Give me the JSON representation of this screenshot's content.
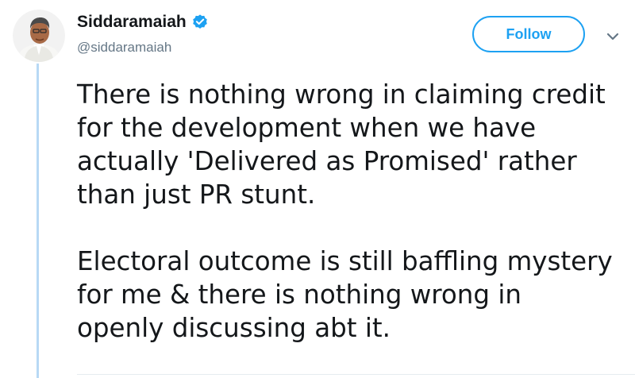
{
  "author": {
    "display_name": "Siddaramaiah",
    "handle": "@siddaramaiah",
    "verified": true
  },
  "actions": {
    "follow_label": "Follow"
  },
  "tweet": {
    "paragraphs": [
      "There is nothing wrong in claiming credit\nfor the development when we have\nactually 'Delivered as Promised' rather\nthan just PR stunt.",
      "Electoral outcome is still baffling mystery\nfor me & there is nothing wrong in\nopenly discussing abt it."
    ]
  },
  "colors": {
    "accent": "#1da1f2",
    "text": "#14171a",
    "muted": "#657786",
    "thread_line": "#b8d9f5"
  },
  "icons": {
    "verified": "verified-badge-icon",
    "menu": "chevron-down-icon"
  }
}
